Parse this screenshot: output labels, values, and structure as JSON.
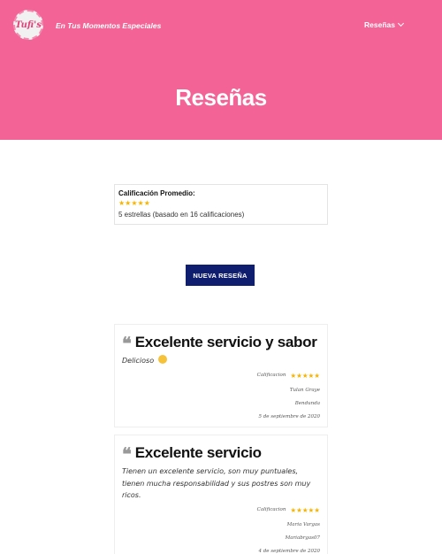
{
  "header": {
    "logo_text": "Tufi's",
    "tagline": "En Tus Momentos Especiales",
    "nav_label": "Reseñas"
  },
  "hero": {
    "title": "Reseñas"
  },
  "summary": {
    "label": "Calificación Promedio:",
    "stars": "★★★★★",
    "text": "5 estrellas (basado en 16 calificaciones)"
  },
  "new_review_button": "NUEVA RESEÑA",
  "reviews": [
    {
      "title": "Excelente servicio y sabor",
      "body": "Delicioso",
      "rating_label": "Calificacion",
      "stars": "★★★★★",
      "author": "Tulan Graye",
      "location": "Bendunda",
      "date": "5 de septiembre de 2020"
    },
    {
      "title": "Excelente servicio",
      "body": "Tienen un excelente servicio, son muy puntuales, tienen mucha responsabilidad y sus postres son muy ricos.",
      "rating_label": "Calificacion",
      "stars": "★★★★★",
      "author": "Maria Vargas",
      "location": "Mariabrgas07",
      "date": "4 de septiembre de 2020"
    }
  ],
  "colors": {
    "brand_pink": "#f36395",
    "button_navy": "#0f1e6e",
    "star": "#f7b500"
  }
}
